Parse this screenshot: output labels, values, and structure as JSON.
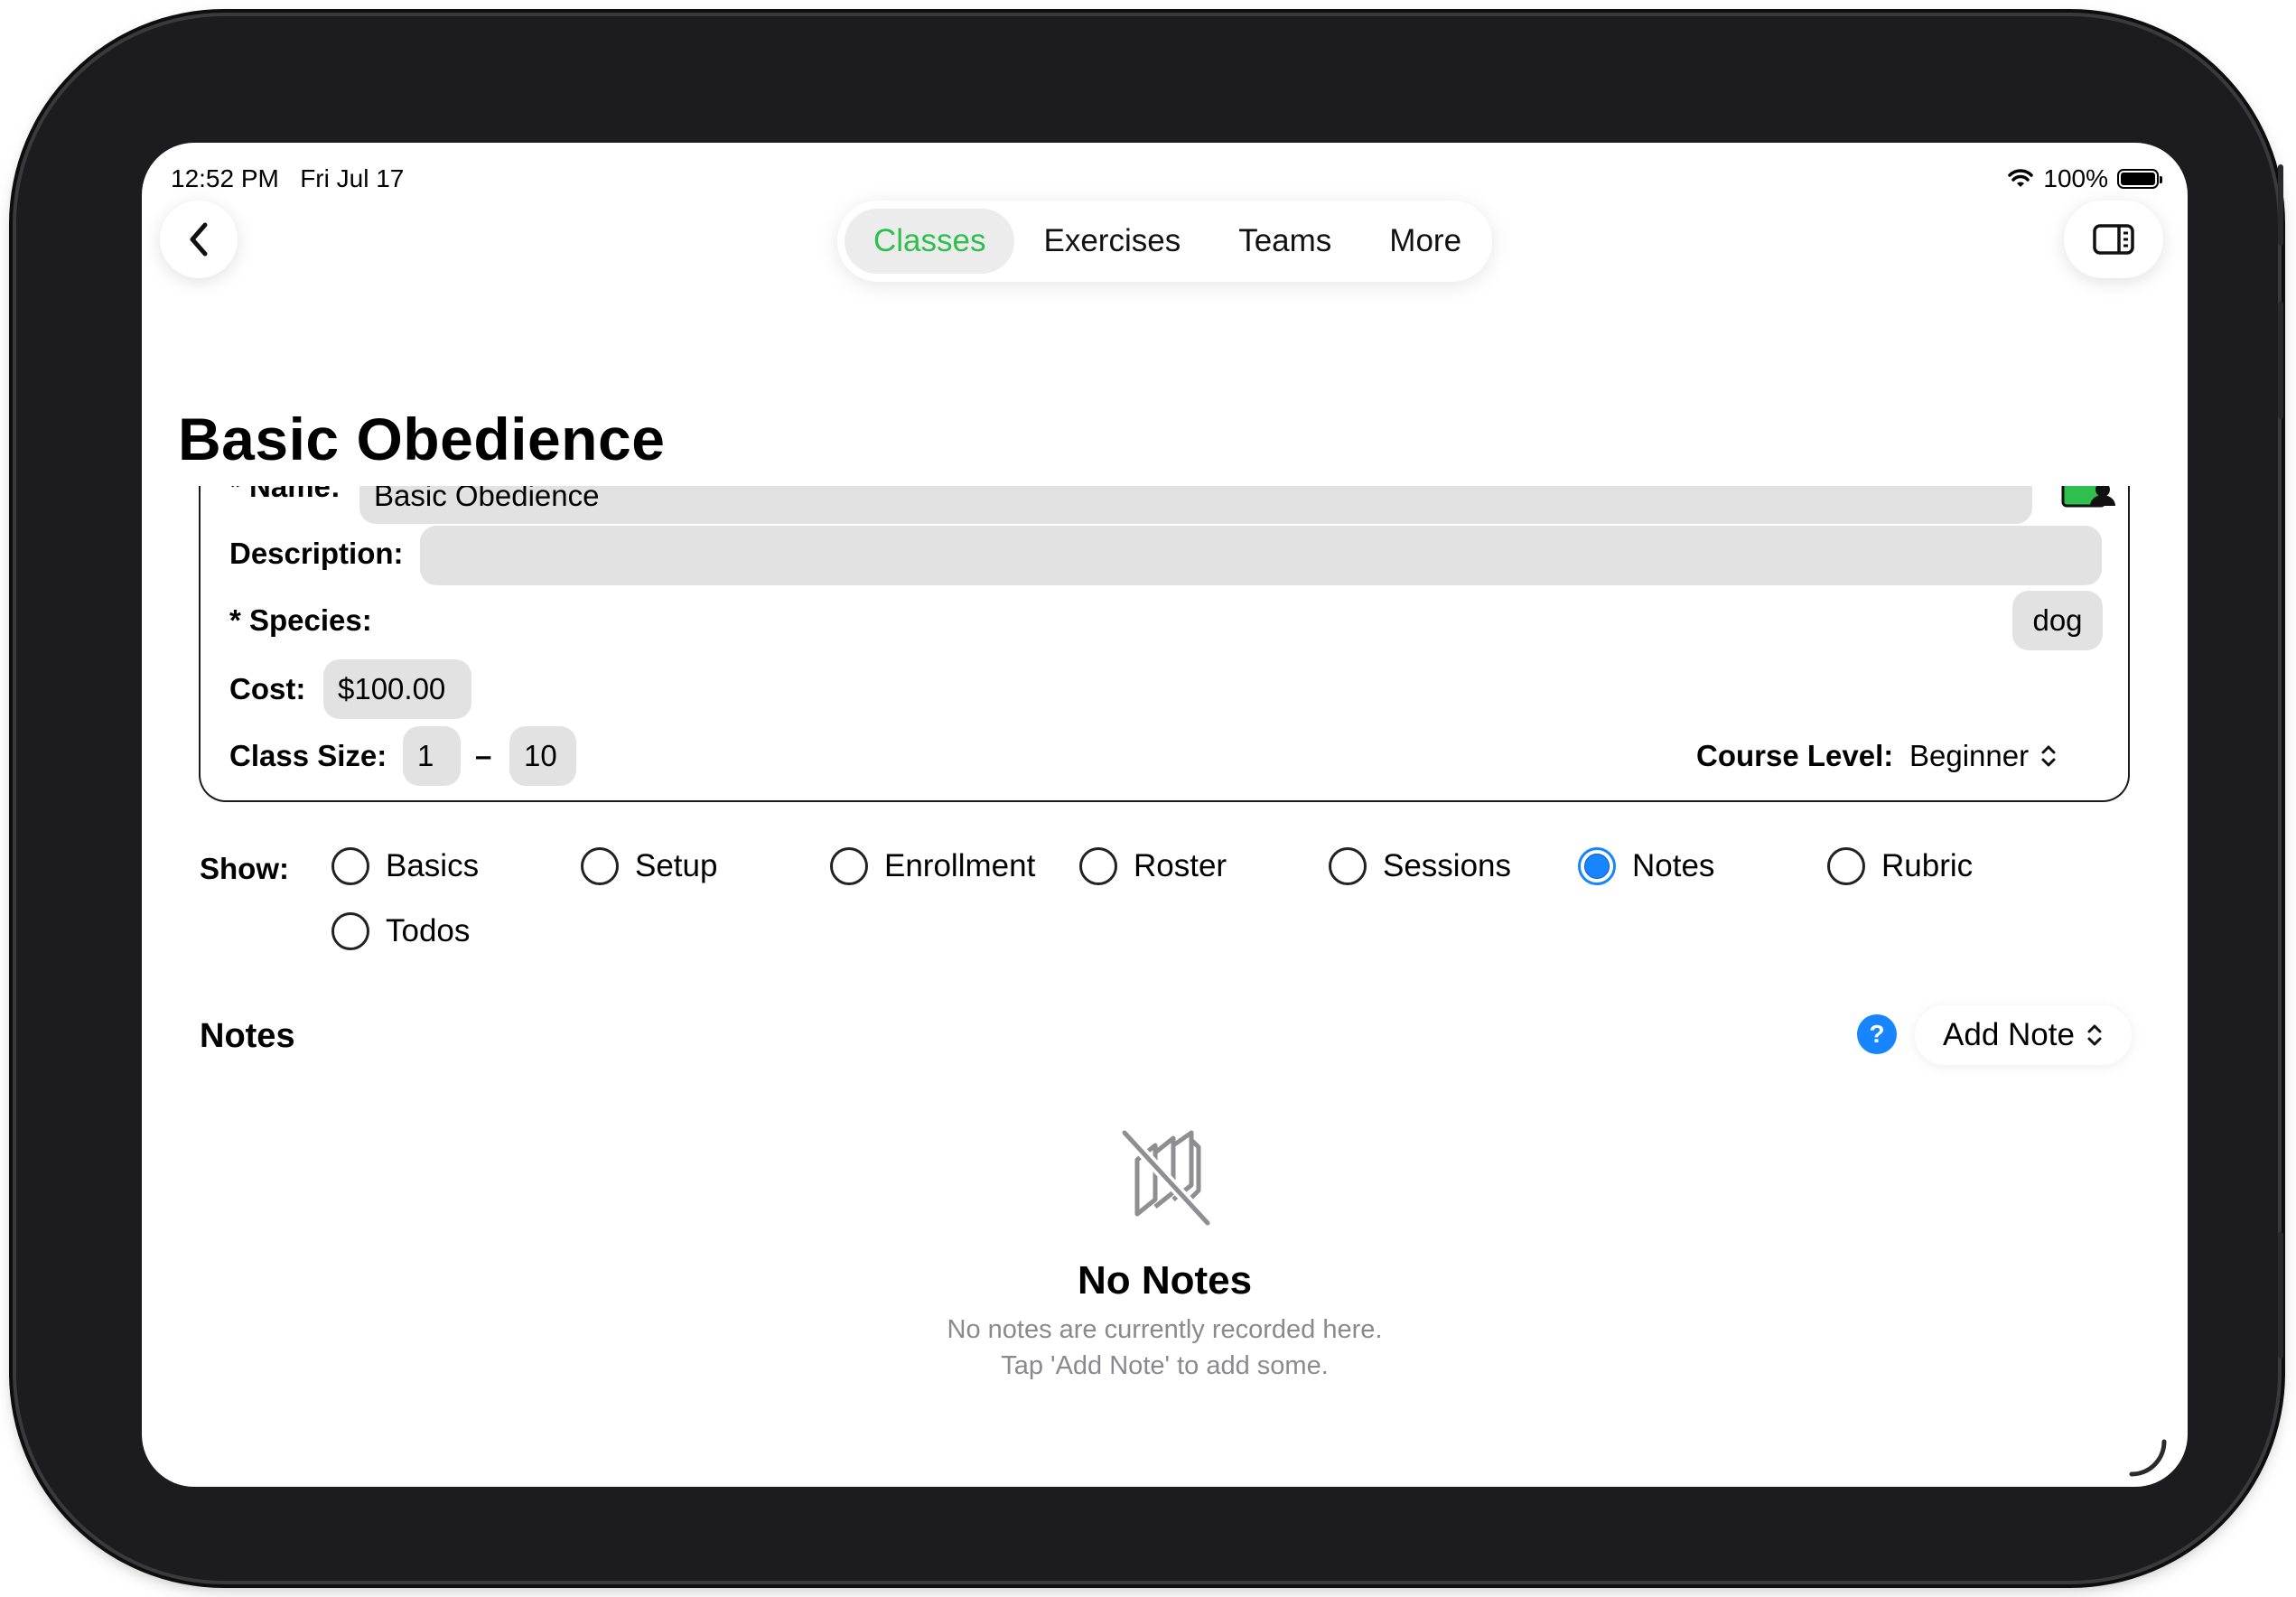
{
  "status_bar": {
    "time": "12:52 PM",
    "date": "Fri Jul 17",
    "battery": "100%"
  },
  "nav": {
    "back_icon": "chevron-left-icon",
    "sidebar_icon": "sidebar-toggle-icon",
    "tabs": [
      {
        "label": "Classes",
        "active": true
      },
      {
        "label": "Exercises",
        "active": false
      },
      {
        "label": "Teams",
        "active": false
      },
      {
        "label": "More",
        "active": false
      }
    ],
    "active_color": "#2fbf4f"
  },
  "page": {
    "title": "Basic Obedience"
  },
  "form": {
    "name_label": "* Name:",
    "name_value": "Basic Obedience",
    "description_label": "Description:",
    "description_value": "",
    "species_label": "* Species:",
    "species_value": "dog",
    "cost_label": "Cost:",
    "cost_value": "$100.00",
    "class_size_label": "Class Size:",
    "class_size_min": "1",
    "class_size_dash": "–",
    "class_size_max": "10",
    "course_level_label": "Course Level:",
    "course_level_value": "Beginner"
  },
  "show": {
    "label": "Show:",
    "options": [
      "Basics",
      "Setup",
      "Enrollment",
      "Roster",
      "Sessions",
      "Notes",
      "Rubric",
      "Todos"
    ],
    "selected": "Notes",
    "accent": "#1685ff"
  },
  "notes": {
    "header": "Notes",
    "help": "?",
    "add_button": "Add Note",
    "empty_title": "No Notes",
    "empty_line1": "No notes are currently recorded here.",
    "empty_line2": "Tap 'Add Note' to add some."
  }
}
